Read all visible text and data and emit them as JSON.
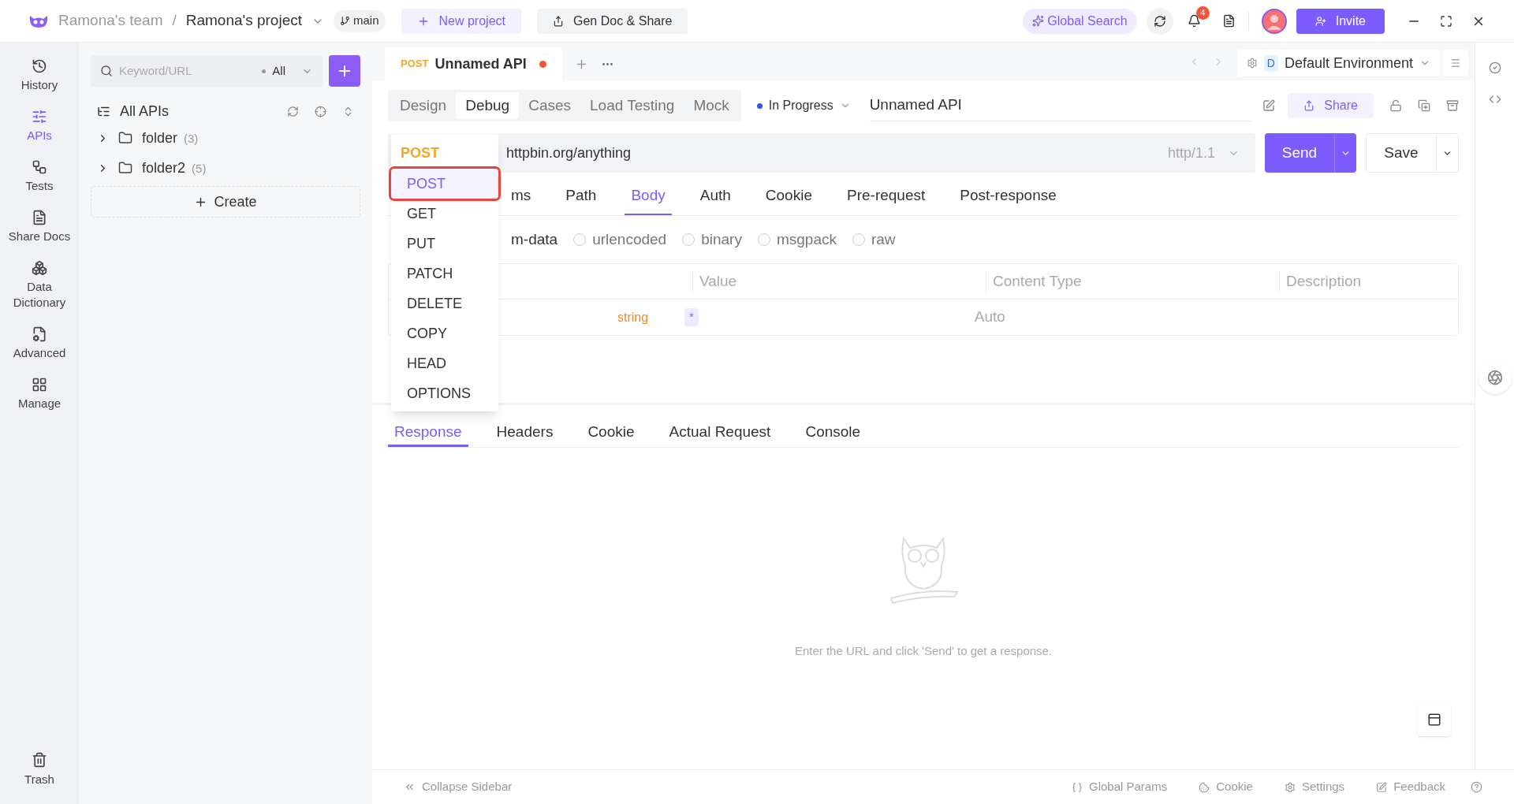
{
  "topbar": {
    "team": "Ramona's team",
    "separator": "/",
    "project": "Ramona's project",
    "branch": "main",
    "new_project": "New project",
    "gen_doc": "Gen Doc & Share",
    "global_search": "Global Search",
    "notifications": "4",
    "invite": "Invite"
  },
  "rail": [
    {
      "label": "History",
      "selected": false
    },
    {
      "label": "APIs",
      "selected": true
    },
    {
      "label": "Tests",
      "selected": false
    },
    {
      "label": "Share Docs",
      "selected": false
    },
    {
      "label": "Data Dictionary",
      "selected": false
    },
    {
      "label": "Advanced",
      "selected": false
    },
    {
      "label": "Manage",
      "selected": false
    }
  ],
  "rail_bottom": {
    "label": "Trash"
  },
  "tree": {
    "search": {
      "placeholder": "Keyword/URL"
    },
    "filter": "All",
    "root": "All APIs",
    "folders": [
      {
        "name": "folder",
        "count": "(3)",
        "expanded": false
      },
      {
        "name": "folder2",
        "count": "(5)",
        "expanded": false
      }
    ],
    "create": "Create"
  },
  "doc_tabs": [
    {
      "method": "POST",
      "title": "Unnamed API",
      "unsaved": true,
      "selected": true
    }
  ],
  "environment": {
    "badge": "D",
    "name": "Default Environment"
  },
  "mode_tabs": [
    {
      "label": "Design",
      "selected": false
    },
    {
      "label": "Debug",
      "selected": true
    },
    {
      "label": "Cases",
      "selected": false
    },
    {
      "label": "Load Testing",
      "selected": false
    },
    {
      "label": "Mock",
      "selected": false
    }
  ],
  "status": {
    "label": "In Progress",
    "color": "#2f54eb"
  },
  "api_name": "Unnamed API",
  "share": "Share",
  "request": {
    "method": "POST",
    "url": "httpbin.org/anything",
    "protocol": "http/1.1",
    "send": "Send",
    "save": "Save"
  },
  "method_menu": [
    {
      "label": "POST",
      "selected": true
    },
    {
      "label": "GET",
      "selected": false
    },
    {
      "label": "PUT",
      "selected": false
    },
    {
      "label": "PATCH",
      "selected": false
    },
    {
      "label": "DELETE",
      "selected": false
    },
    {
      "label": "COPY",
      "selected": false
    },
    {
      "label": "HEAD",
      "selected": false
    },
    {
      "label": "OPTIONS",
      "selected": false
    }
  ],
  "request_tabs": [
    {
      "label": "ms",
      "selected": false
    },
    {
      "label": "Path",
      "selected": false
    },
    {
      "label": "Body",
      "selected": true
    },
    {
      "label": "Auth",
      "selected": false
    },
    {
      "label": "Cookie",
      "selected": false
    },
    {
      "label": "Pre-request",
      "selected": false
    },
    {
      "label": "Post-response",
      "selected": false
    }
  ],
  "body_types": [
    {
      "label": "m-data",
      "selected": true,
      "radio_visible": false
    },
    {
      "label": "urlencoded",
      "selected": false,
      "radio_visible": true
    },
    {
      "label": "binary",
      "selected": false,
      "radio_visible": true
    },
    {
      "label": "msgpack",
      "selected": false,
      "radio_visible": true
    },
    {
      "label": "raw",
      "selected": false,
      "radio_visible": true
    }
  ],
  "table": {
    "columns": [
      "Value",
      "Content Type",
      "Description"
    ],
    "rows": [
      {
        "type": "string",
        "required": "*",
        "content_type": "Auto"
      }
    ]
  },
  "response_tabs": [
    {
      "label": "Response",
      "selected": true
    },
    {
      "label": "Headers",
      "selected": false
    },
    {
      "label": "Cookie",
      "selected": false
    },
    {
      "label": "Actual Request",
      "selected": false
    },
    {
      "label": "Console",
      "selected": false
    }
  ],
  "empty_message": "Enter the URL and click 'Send' to get a response.",
  "footer": {
    "collapse": "Collapse Sidebar",
    "items": [
      {
        "label": "Global Params"
      },
      {
        "label": "Cookie"
      },
      {
        "label": "Settings"
      },
      {
        "label": "Feedback"
      }
    ]
  }
}
